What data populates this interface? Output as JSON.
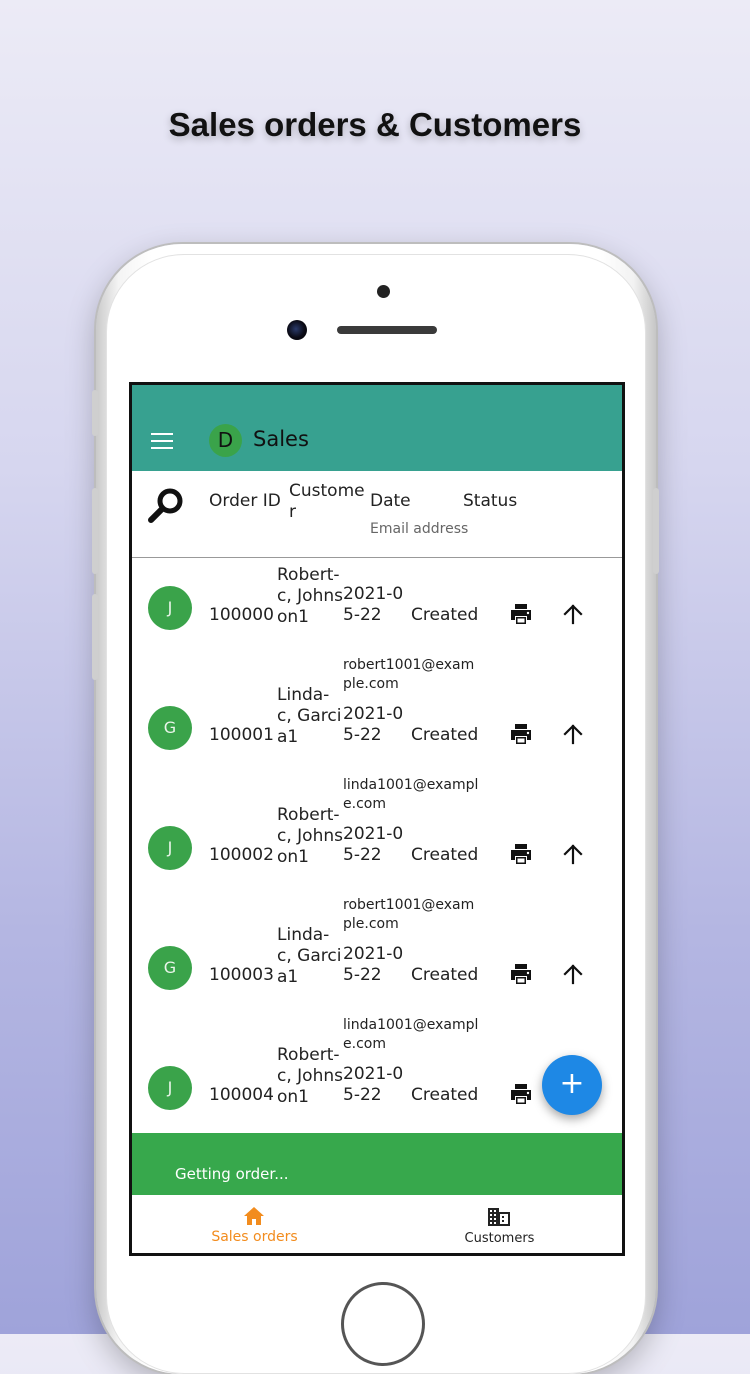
{
  "headline": "Sales orders & Customers",
  "app": {
    "title": "Sales",
    "logo_letter": "D"
  },
  "table_header": {
    "order_id": "Order ID",
    "customer": "Custome r",
    "date": "Date",
    "status": "Status",
    "email": "Email address"
  },
  "orders": [
    {
      "avatar": "J",
      "id": "100000",
      "customer": "Robert-c, Johnson1",
      "date": "2021-05-22",
      "status": "Created",
      "email": "robert1001@example.com",
      "has_arrow": true
    },
    {
      "avatar": "G",
      "id": "100001",
      "customer": "Linda-c, Garcia1",
      "date": "2021-05-22",
      "status": "Created",
      "email": "linda1001@example.com",
      "has_arrow": true
    },
    {
      "avatar": "J",
      "id": "100002",
      "customer": "Robert-c, Johnson1",
      "date": "2021-05-22",
      "status": "Created",
      "email": "robert1001@example.com",
      "has_arrow": true
    },
    {
      "avatar": "G",
      "id": "100003",
      "customer": "Linda-c, Garcia1",
      "date": "2021-05-22",
      "status": "Created",
      "email": "linda1001@example.com",
      "has_arrow": true
    },
    {
      "avatar": "J",
      "id": "100004",
      "customer": "Robert-c, Johnson1",
      "date": "2021-05-22",
      "status": "Created",
      "email": "",
      "has_arrow": false
    }
  ],
  "snackbar": "Getting order...",
  "fab_label": "+",
  "bottom_nav": [
    {
      "label": "Sales orders",
      "icon": "home-icon",
      "active": true
    },
    {
      "label": "Customers",
      "icon": "building-icon",
      "active": false
    }
  ],
  "colors": {
    "appbar": "#37a190",
    "avatar": "#3aa34a",
    "snackbar": "#37a84c",
    "fab": "#1e88e5",
    "active_nav": "#f28c1e"
  }
}
